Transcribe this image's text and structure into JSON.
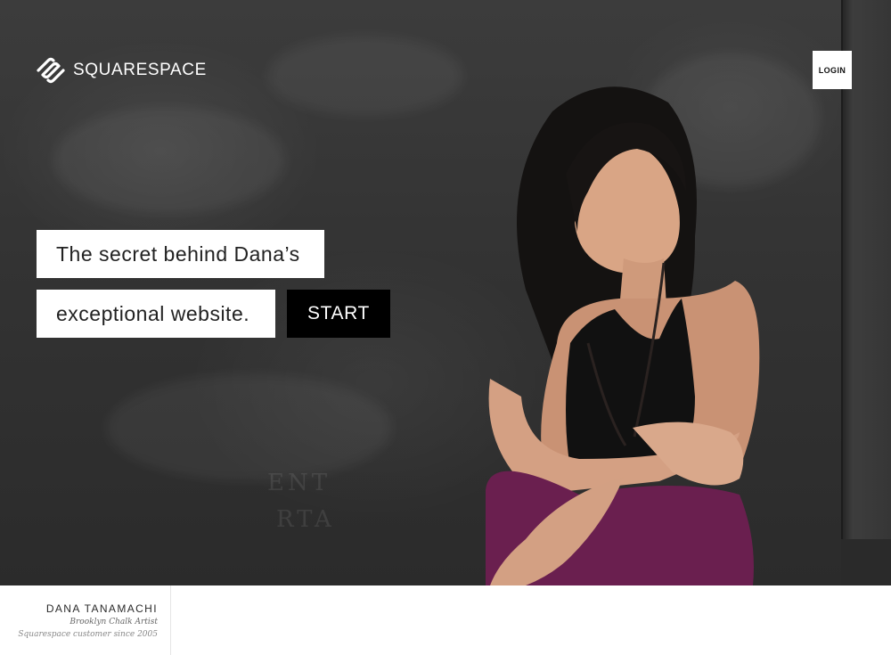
{
  "brand": {
    "name": "SQUARESPACE",
    "logo_icon": "squarespace-logo-icon"
  },
  "header": {
    "login_label": "LOGIN"
  },
  "hero": {
    "headline_line_1": "The secret behind Dana’s",
    "headline_line_2": "exceptional website.",
    "start_label": "START",
    "chalk_fragment_1": "ENT",
    "chalk_fragment_2": "RTA"
  },
  "caption": {
    "name": "DANA TANAMACHI",
    "role": "Brooklyn Chalk Artist",
    "since": "Squarespace customer since 2005"
  },
  "colors": {
    "chalkboard": "#333333",
    "headline_box": "#ffffff",
    "start_button": "#000000",
    "dress": "#6a1f4f"
  }
}
